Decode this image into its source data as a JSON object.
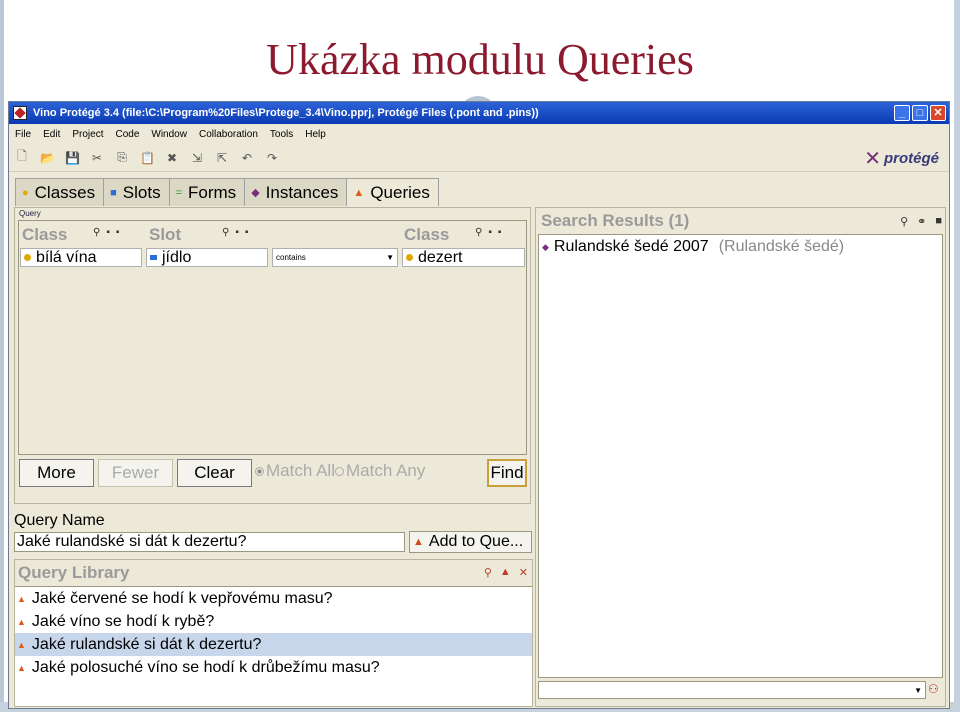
{
  "slide_title": "Ukázka modulu Queries",
  "window": {
    "title": "Vino  Protégé 3.4     (file:\\C:\\Program%20Files\\Protege_3.4\\Vino.pprj, Protégé Files (.pont and .pins))",
    "buttons": {
      "minimize": "_",
      "maximize": "□",
      "close": "✕"
    }
  },
  "menu": [
    "File",
    "Edit",
    "Project",
    "Code",
    "Window",
    "Collaboration",
    "Tools",
    "Help"
  ],
  "toolbar": {
    "icons": [
      "new-icon",
      "open-icon",
      "save-icon",
      "cut-icon",
      "copy-icon",
      "paste-icon",
      "delete-icon",
      "import-icon",
      "export-icon",
      "back-icon",
      "forward-icon"
    ],
    "glyphs": [
      "🗋",
      "📂",
      "💾",
      "✂",
      "⎘",
      "📋",
      "✖",
      "⇲",
      "⇱",
      "↶",
      "↷"
    ],
    "logo_text": "protégé"
  },
  "tabs": [
    {
      "label": "Classes",
      "icon": "●",
      "color": "#e0a800"
    },
    {
      "label": "Slots",
      "icon": "■",
      "color": "#2a6fd6"
    },
    {
      "label": "Forms",
      "icon": "=",
      "color": "#2e9a3a"
    },
    {
      "label": "Instances",
      "icon": "◆",
      "color": "#7a2d7a"
    },
    {
      "label": "Queries",
      "icon": "▲",
      "color": "#e05a1a"
    }
  ],
  "query": {
    "group_label": "Query",
    "col_class_1": "Class",
    "col_slot": "Slot",
    "col_class_2": "Class",
    "class_value": "bílá vína",
    "slot_value": "jídlo",
    "operator": "contains",
    "target_class": "dezert",
    "buttons": {
      "more": "More",
      "fewer": "Fewer",
      "clear": "Clear",
      "find": "Find"
    },
    "match_all": "Match All",
    "match_any": "Match Any"
  },
  "query_name": {
    "label": "Query Name",
    "value": "Jaké rulandské si dát k dezertu?",
    "add_button": "Add to Que..."
  },
  "library": {
    "title": "Query Library",
    "items": [
      "Jaké červené se hodí k vepřovému masu?",
      "Jaké víno se hodí k rybě?",
      "Jaké rulandské si dát k dezertu?",
      "Jaké polosuché víno se hodí k drůbežímu masu?"
    ],
    "selected_index": 2
  },
  "results": {
    "title": "Search Results (1)",
    "items": [
      {
        "name": "Rulandské šedé 2007",
        "type": "(Rulandské šedé)"
      }
    ]
  }
}
